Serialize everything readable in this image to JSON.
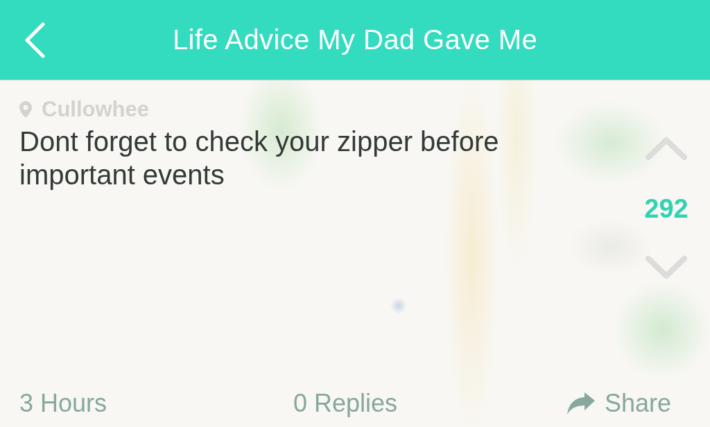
{
  "header": {
    "title": "Life Advice My Dad Gave Me"
  },
  "post": {
    "location": "Cullowhee",
    "message": "Dont forget to check your zipper before important events",
    "votes": {
      "count": "292"
    },
    "footer": {
      "time": "3 Hours",
      "replies": "0 Replies",
      "share": "Share"
    }
  }
}
